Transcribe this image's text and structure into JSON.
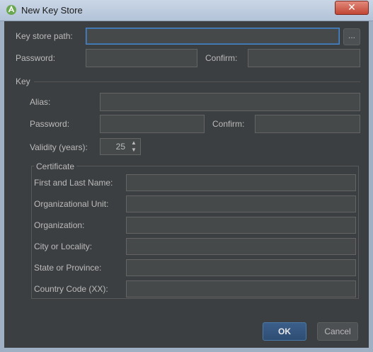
{
  "window": {
    "title": "New Key Store",
    "close_glyph": "✕"
  },
  "keystore": {
    "path_label": "Key store path:",
    "path_value": "",
    "browse_label": "...",
    "password_label": "Password:",
    "confirm_label": "Confirm:"
  },
  "key": {
    "section_label": "Key",
    "alias_label": "Alias:",
    "password_label": "Password:",
    "confirm_label": "Confirm:",
    "validity_label": "Validity (years):",
    "validity_value": "25"
  },
  "certificate": {
    "group_label": "Certificate",
    "fields": [
      {
        "label": "First and Last Name:",
        "value": ""
      },
      {
        "label": "Organizational Unit:",
        "value": ""
      },
      {
        "label": "Organization:",
        "value": ""
      },
      {
        "label": "City or Locality:",
        "value": ""
      },
      {
        "label": "State or Province:",
        "value": ""
      },
      {
        "label": "Country Code (XX):",
        "value": ""
      }
    ]
  },
  "buttons": {
    "ok": "OK",
    "cancel": "Cancel"
  },
  "icons": {
    "app": "android-studio-icon",
    "close": "close-icon",
    "spinner_up": "chevron-up-icon",
    "spinner_down": "chevron-down-icon"
  },
  "colors": {
    "background": "#3c3f41",
    "field": "#45494a",
    "focus": "#4a88c7",
    "ok_button": "#365880"
  }
}
